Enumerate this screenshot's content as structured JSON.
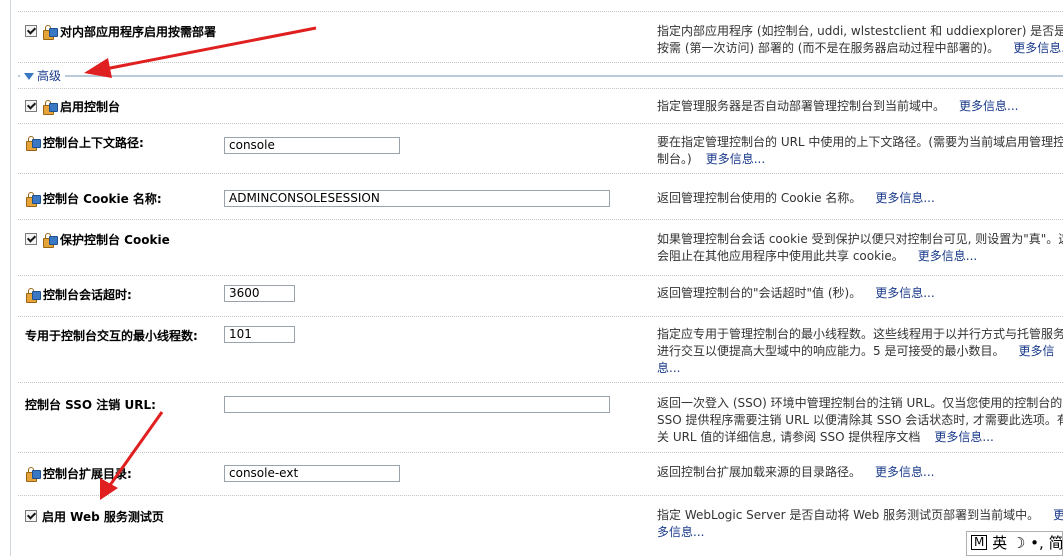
{
  "rows": [
    {
      "label": "对内部应用程序启用按需部署",
      "checkbox": true,
      "lock": true,
      "desc": "指定内部应用程序 (如控制台, uddi, wlstestclient 和 uddiexplorer) 是否是按需 (第一次访问) 部署的 (而不是在服务器启动过程中部署的)。",
      "more": "更多信息..."
    },
    {
      "label": "启用控制台",
      "checkbox": true,
      "lock": true,
      "desc": "指定管理服务器是否自动部署管理控制台到当前域中。",
      "more": "更多信息..."
    },
    {
      "label": "控制台上下文路径:",
      "lock": true,
      "value": "console",
      "desc": "要在指定管理控制台的 URL 中使用的上下文路径。(需要为当前域启用管理控制台。)",
      "more": "更多信息..."
    },
    {
      "label": "控制台 Cookie 名称:",
      "lock": true,
      "value": "ADMINCONSOLESESSION",
      "desc": "返回管理控制台使用的 Cookie 名称。",
      "more": "更多信息..."
    },
    {
      "label": "保护控制台 Cookie",
      "checkbox": true,
      "lock": true,
      "desc": "如果管理控制台会话 cookie 受到保护以便只对控制台可见, 则设置为\"真\"。这会阻止在其他应用程序中使用此共享 cookie。",
      "more": "更多信息..."
    },
    {
      "label": "控制台会话超时:",
      "lock": true,
      "value": "3600",
      "desc": "返回管理控制台的\"会话超时\"值 (秒)。",
      "more": "更多信息..."
    },
    {
      "label": "专用于控制台交互的最小线程数:",
      "value": "101",
      "desc": "指定应专用于管理控制台的最小线程数。这些线程用于以并行方式与托管服务器进行交互以便提高大型域中的响应能力。5 是可接受的最小数目。",
      "more": "更多信息..."
    },
    {
      "label": "控制台 SSO 注销 URL:",
      "value": "",
      "desc": "返回一次登入 (SSO) 环境中管理控制台的注销 URL。仅当您使用的控制台的 SSO 提供程序需要注销 URL 以便清除其 SSO 会话状态时, 才需要此选项。有关 URL 值的详细信息, 请参阅 SSO 提供程序文档",
      "more": "更多信息..."
    },
    {
      "label": "控制台扩展目录:",
      "lock": true,
      "value": "console-ext",
      "desc": "返回控制台扩展加载来源的目录路径。",
      "more": "更多信息..."
    },
    {
      "label": "启用 Web 服务测试页",
      "checkbox": true,
      "desc": "指定 WebLogic Server 是否自动将 Web 服务测试页部署到当前域中。",
      "more": "更多信息..."
    }
  ],
  "advanced_label": "高级",
  "ime": {
    "mode": "M",
    "lang": "英",
    "moon": "☽",
    "punct": "•,",
    "script": "简"
  },
  "colors": {
    "link": "#1a3a8a",
    "arrow": "#e02020"
  }
}
